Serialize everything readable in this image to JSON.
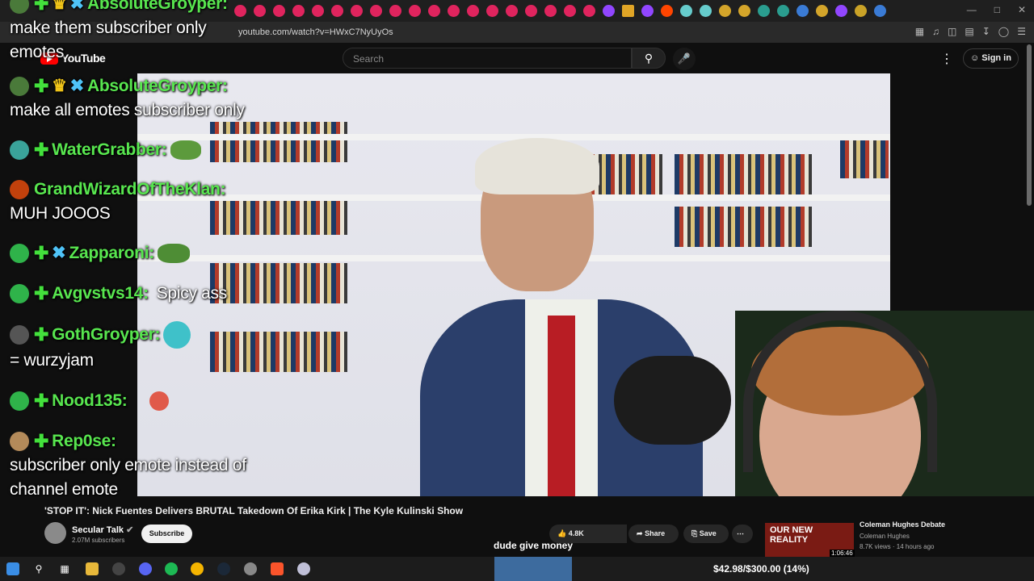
{
  "browser": {
    "url": "youtube.com/watch?v=HWxC7NyUyOs"
  },
  "youtube": {
    "logo": "YouTube",
    "search_placeholder": "Search",
    "sign_in": "Sign in",
    "video_title": "'STOP IT': Nick Fuentes Delivers BRUTAL Takedown Of Erika Kirk | The Kyle Kulinski Show",
    "channel_name": "Secular Talk",
    "channel_subs": "2.07M subscribers",
    "subscribe_label": "Subscribe",
    "likes": "4.8K",
    "share_label": "Share",
    "save_label": "Save",
    "overlay_caption": "dude give money"
  },
  "recommendation": {
    "thumb_text": "OUR NEW REALITY",
    "duration": "1:06:46",
    "title": "Coleman Hughes Debate",
    "channel": "Coleman Hughes",
    "meta": "8.7K views · 14 hours ago"
  },
  "chat": [
    {
      "user": "AbsoluteGroyper:",
      "text": "make them subscriber only emotes"
    },
    {
      "user": "AbsoluteGroyper:",
      "text": "make all emotes subscriber only"
    },
    {
      "user": "WaterGrabber:",
      "text": ""
    },
    {
      "user": "GrandWizardOfTheKlan:",
      "text": "MUH JOOOS"
    },
    {
      "user": "Zapparoni:",
      "text": ""
    },
    {
      "user": "Avgvstvs14:",
      "text": "Spicy ass"
    },
    {
      "user": "GothGroyper:",
      "text": "= wurzyjam"
    },
    {
      "user": "Nood135:",
      "text": ""
    },
    {
      "user": "Rep0se:",
      "text": "subscriber only emote instead of channel emote"
    }
  ],
  "taskbar": {
    "donation_goal": "$42.98/$300.00 (14%)"
  },
  "colors": {
    "chat_name": "#58e64f",
    "yt_red": "#ff0000",
    "background": "#0f0f0f"
  }
}
